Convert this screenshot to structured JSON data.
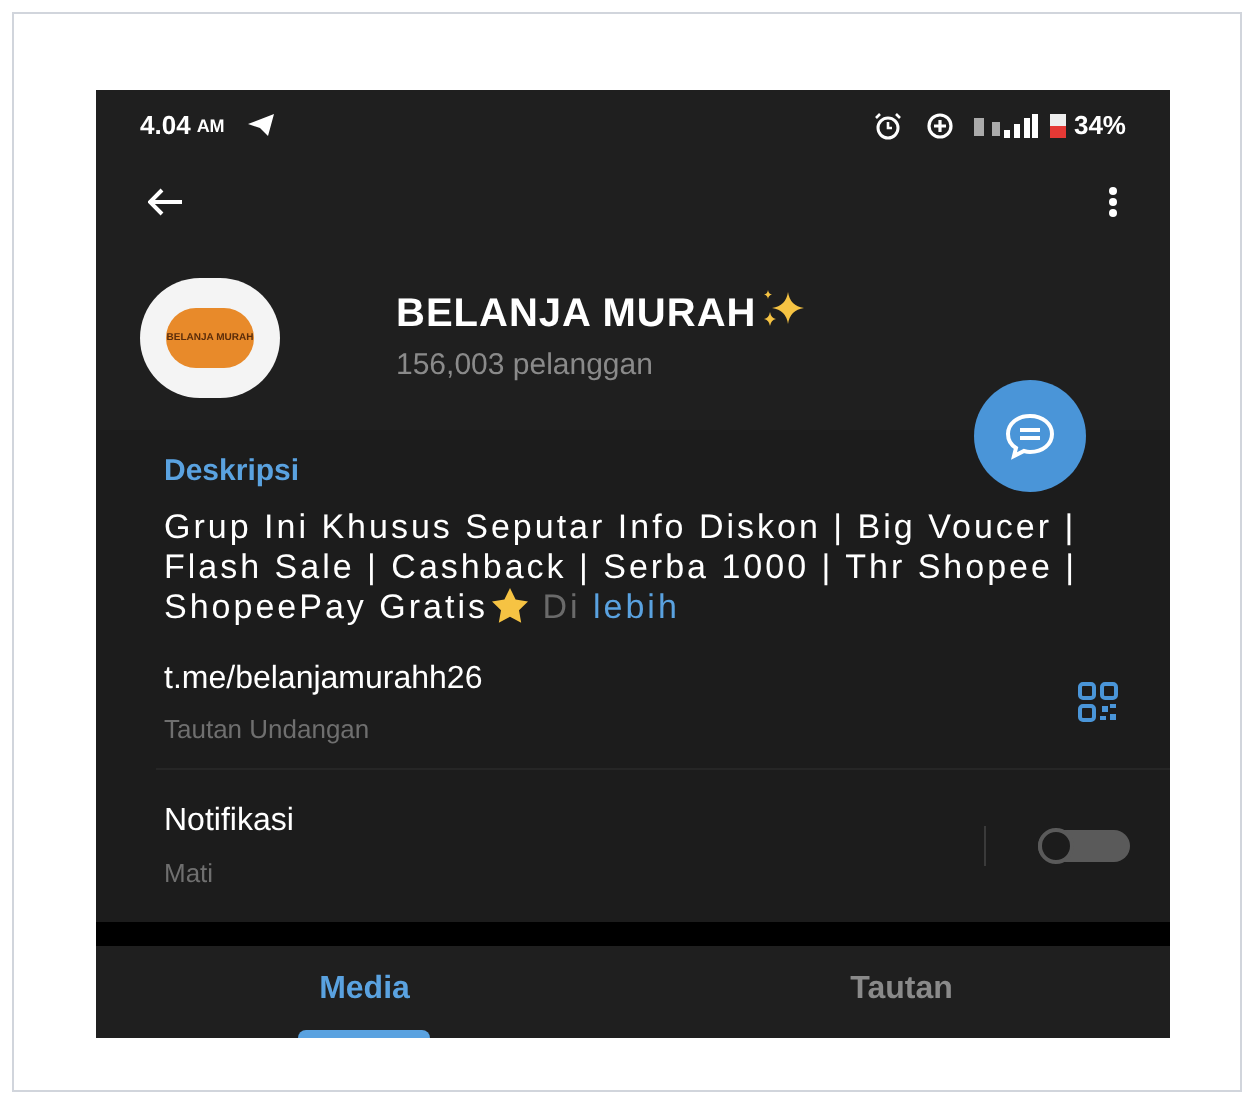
{
  "status_bar": {
    "time": "4.04",
    "meridiem": "AM",
    "battery": "34%"
  },
  "channel": {
    "name": "BELANJA MURAH",
    "subscribers": "156,003 pelanggan",
    "logo_text": "BELANJA MURAH"
  },
  "description": {
    "heading": "Deskripsi",
    "text": "Grup Ini Khusus Seputar Info Diskon | Big Voucer | Flash Sale | Cashback | Serba 1000 | Thr Shopee | ShopeePay Gratis",
    "faded_text": "Di",
    "more_link": "lebih"
  },
  "invite_link": {
    "url": "t.me/belanjamurahh26",
    "caption": "Tautan Undangan"
  },
  "notifications": {
    "label": "Notifikasi",
    "value": "Mati",
    "on": false
  },
  "tabs": [
    {
      "label": "Media",
      "selected": true
    },
    {
      "label": "Tautan",
      "selected": false
    }
  ]
}
